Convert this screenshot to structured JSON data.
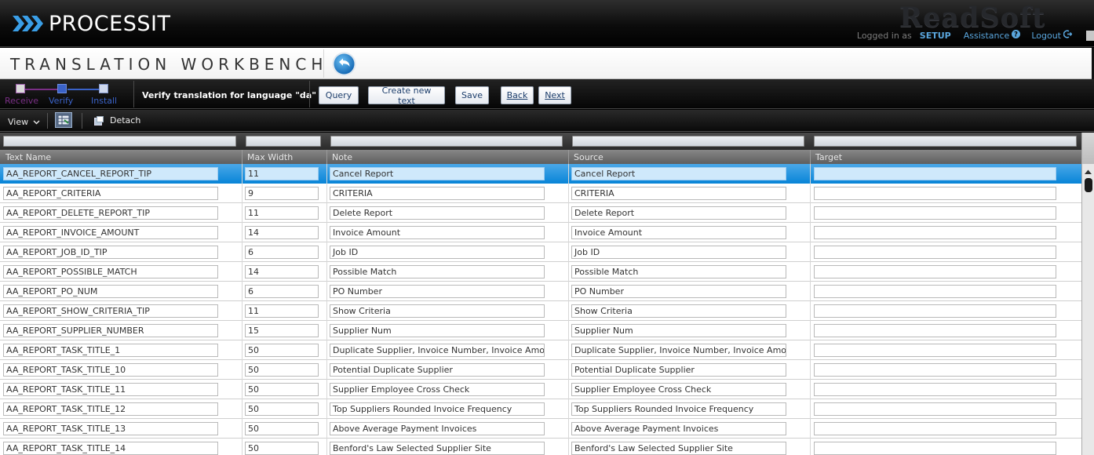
{
  "brand": {
    "name": "PROCESSIT",
    "watermark": "ReadSoft",
    "accent": "#3a9ee6"
  },
  "user": {
    "logged_in_label": "Logged in as",
    "username": "SETUP",
    "assistance_label": "Assistance",
    "assistance_icon": "help-circle-icon",
    "logout_label": "Logout",
    "logout_icon": "logout-icon"
  },
  "page": {
    "title": "TRANSLATION WORKBENCH",
    "back_icon": "back-arrow-icon"
  },
  "workflow": {
    "steps": [
      {
        "label": "Receive",
        "color": "#7a2f86"
      },
      {
        "label": "Verify",
        "color": "#3a62c8"
      },
      {
        "label": "Install",
        "color": "#3a62c8"
      }
    ],
    "current_step": "Verify"
  },
  "actions": {
    "instruction": "Verify translation for language \"da\"",
    "buttons": {
      "query": "Query",
      "create_new_text": "Create new text",
      "save": "Save",
      "back": "Back",
      "next": "Next"
    }
  },
  "toolbar": {
    "view_label": "View",
    "detach_label": "Detach"
  },
  "grid": {
    "columns": [
      "Text Name",
      "Max Width",
      "Note",
      "Source",
      "Target"
    ],
    "rows": [
      {
        "name": "AA_REPORT_CANCEL_REPORT_TIP",
        "max": "11",
        "note": "Cancel Report",
        "source": "Cancel Report",
        "target": ""
      },
      {
        "name": "AA_REPORT_CRITERIA",
        "max": "9",
        "note": "CRITERIA",
        "source": "CRITERIA",
        "target": ""
      },
      {
        "name": "AA_REPORT_DELETE_REPORT_TIP",
        "max": "11",
        "note": "Delete Report",
        "source": "Delete Report",
        "target": ""
      },
      {
        "name": "AA_REPORT_INVOICE_AMOUNT",
        "max": "14",
        "note": "Invoice Amount",
        "source": "Invoice Amount",
        "target": ""
      },
      {
        "name": "AA_REPORT_JOB_ID_TIP",
        "max": "6",
        "note": "Job ID",
        "source": "Job ID",
        "target": ""
      },
      {
        "name": "AA_REPORT_POSSIBLE_MATCH",
        "max": "14",
        "note": "Possible Match",
        "source": "Possible Match",
        "target": ""
      },
      {
        "name": "AA_REPORT_PO_NUM",
        "max": "6",
        "note": "PO Number",
        "source": "PO Number",
        "target": ""
      },
      {
        "name": "AA_REPORT_SHOW_CRITERIA_TIP",
        "max": "11",
        "note": "Show Criteria",
        "source": "Show Criteria",
        "target": ""
      },
      {
        "name": "AA_REPORT_SUPPLIER_NUMBER",
        "max": "15",
        "note": "Supplier Num",
        "source": "Supplier Num",
        "target": ""
      },
      {
        "name": "AA_REPORT_TASK_TITLE_1",
        "max": "50",
        "note": "Duplicate Supplier, Invoice Number, Invoice Amount",
        "source": "Duplicate Supplier, Invoice Number, Invoice Amount",
        "target": ""
      },
      {
        "name": "AA_REPORT_TASK_TITLE_10",
        "max": "50",
        "note": "Potential Duplicate Supplier",
        "source": "Potential Duplicate Supplier",
        "target": ""
      },
      {
        "name": "AA_REPORT_TASK_TITLE_11",
        "max": "50",
        "note": "Supplier Employee Cross Check",
        "source": "Supplier Employee Cross Check",
        "target": ""
      },
      {
        "name": "AA_REPORT_TASK_TITLE_12",
        "max": "50",
        "note": "Top Suppliers Rounded Invoice Frequency",
        "source": "Top Suppliers Rounded Invoice Frequency",
        "target": ""
      },
      {
        "name": "AA_REPORT_TASK_TITLE_13",
        "max": "50",
        "note": "Above Average Payment Invoices",
        "source": "Above Average Payment Invoices",
        "target": ""
      },
      {
        "name": "AA_REPORT_TASK_TITLE_14",
        "max": "50",
        "note": "Benford's Law Selected Supplier Site",
        "source": "Benford's Law Selected Supplier Site",
        "target": ""
      }
    ],
    "selected_row": 0
  }
}
